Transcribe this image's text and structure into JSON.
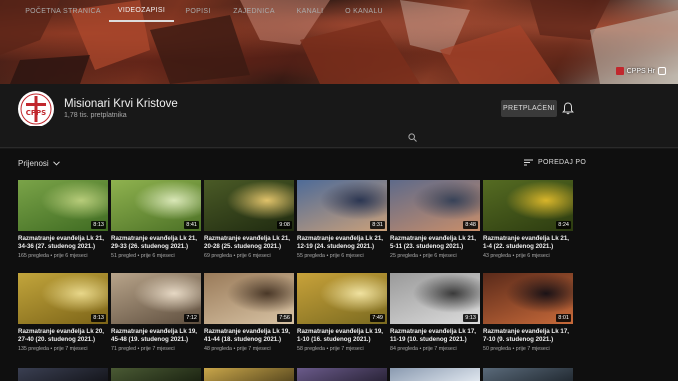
{
  "banner": {
    "link_label": "CPPS Hr"
  },
  "channel": {
    "name": "Misionari Krvi Kristove",
    "subscribers": "1,78 tis. pretplatnika",
    "avatar_text": "CPPS",
    "subscribe_label": "PRETPLAĆENI"
  },
  "tabs": [
    {
      "label": "POČETNA STRANICA",
      "active": false
    },
    {
      "label": "VIDEOZAPISI",
      "active": true
    },
    {
      "label": "POPISI",
      "active": false
    },
    {
      "label": "ZAJEDNICA",
      "active": false
    },
    {
      "label": "KANALI",
      "active": false
    },
    {
      "label": "O KANALU",
      "active": false
    }
  ],
  "filters": {
    "uploads_label": "Prijenosi",
    "sort_label": "POREDAJ PO"
  },
  "videos": [
    {
      "title": "Razmatranje evanđelja Lk 21, 34-36 (27. studenog 2021.)",
      "views": "165 pregleda",
      "age": "prije 6 mjeseci",
      "duration": "8:13",
      "colors": [
        "#7aa348",
        "#3f6b22",
        "#b7cc7a"
      ]
    },
    {
      "title": "Razmatranje evanđelja Lk 21, 29-33 (26. studenog 2021.)",
      "views": "51 pregled",
      "age": "prije 6 mjeseci",
      "duration": "8:41",
      "colors": [
        "#8fb24f",
        "#4c7126",
        "#d9e7b7"
      ]
    },
    {
      "title": "Razmatranje evanđelja Lk 21, 20-28 (25. studenog 2021.)",
      "views": "69 pregleda",
      "age": "prije 6 mjeseci",
      "duration": "9:08",
      "colors": [
        "#4a5a26",
        "#1f2a10",
        "#e0c26a"
      ]
    },
    {
      "title": "Razmatranje evanđelja Lk 21, 12-19 (24. studenog 2021.)",
      "views": "55 pregleda",
      "age": "prije 6 mjeseci",
      "duration": "8:31",
      "colors": [
        "#4e6b98",
        "#caa07a",
        "#2b3652"
      ]
    },
    {
      "title": "Razmatranje evanđelja Lk 21, 5-11 (23. studenog 2021.)",
      "views": "25 pregleda",
      "age": "prije 6 mjeseci",
      "duration": "8:48",
      "colors": [
        "#5e6a8a",
        "#c98e6a",
        "#374258"
      ]
    },
    {
      "title": "Razmatranje evanđelja Lk 21, 1-4 (22. studenog 2021.)",
      "views": "43 pregleda",
      "age": "prije 6 mjeseci",
      "duration": "8:24",
      "colors": [
        "#556b22",
        "#2c3b10",
        "#d8b52a"
      ]
    },
    {
      "title": "Razmatranje evanđelja Lk 20, 27-40 (20. studenog 2021.)",
      "views": "135 pregleda",
      "age": "prije 7 mjeseci",
      "duration": "8:13",
      "colors": [
        "#c2a53c",
        "#7c6418",
        "#e8d78a"
      ]
    },
    {
      "title": "Razmatranje evanđelja Lk 19, 45-48 (19. studenog 2021.)",
      "views": "71 pregled",
      "age": "prije 7 mjeseci",
      "duration": "7:12",
      "colors": [
        "#b8a48a",
        "#5e4e3e",
        "#e6d8c4"
      ]
    },
    {
      "title": "Razmatranje evanđelja Lk 19, 41-44 (18. studenog 2021.)",
      "views": "48 pregleda",
      "age": "prije 7 mjeseci",
      "duration": "7:56",
      "colors": [
        "#9a7b5a",
        "#d8c3a4",
        "#4a3828"
      ]
    },
    {
      "title": "Razmatranje evanđelja Lk 19, 1-10 (16. studenog 2021.)",
      "views": "58 pregleda",
      "age": "prije 7 mjeseci",
      "duration": "7:49",
      "colors": [
        "#c8a23a",
        "#7a6a20",
        "#f0e2a0"
      ]
    },
    {
      "title": "Razmatranje evanđelja Lk 17, 11-19 (10. studenog 2021.)",
      "views": "84 pregleda",
      "age": "prije 7 mjeseci",
      "duration": "9:13",
      "colors": [
        "#9a9a9a",
        "#dcdcdc",
        "#3a3a3a"
      ]
    },
    {
      "title": "Razmatranje evanđelja Lk 17, 7-10 (9. studenog 2021.)",
      "views": "50 pregleda",
      "age": "prije 7 mjeseci",
      "duration": "8:01",
      "colors": [
        "#5a2a1a",
        "#c86a3a",
        "#1a1216"
      ]
    }
  ],
  "bottom_thumbs": [
    {
      "colors": [
        "#3a3f52",
        "#15161c"
      ]
    },
    {
      "colors": [
        "#4a5a34",
        "#1c2412"
      ]
    },
    {
      "colors": [
        "#c9a64a",
        "#5a4a20"
      ]
    },
    {
      "colors": [
        "#6a5a8a",
        "#2a2438"
      ]
    },
    {
      "colors": [
        "#8a9ab0",
        "#dfe6ee"
      ]
    },
    {
      "colors": [
        "#5a6a7a",
        "#222a32"
      ]
    }
  ]
}
